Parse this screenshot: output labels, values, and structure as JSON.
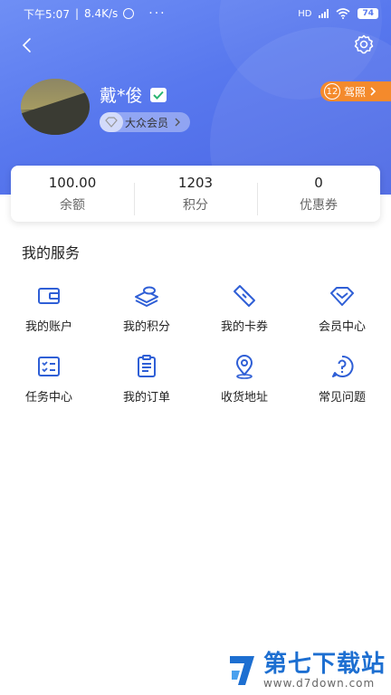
{
  "status_bar": {
    "time": "下午5:07",
    "speed": "8.4K/s",
    "more": "···",
    "network": "HD",
    "battery": "74"
  },
  "profile": {
    "name": "戴*俊",
    "member_level": "大众会员",
    "license_count": "12",
    "license_label": "驾照"
  },
  "stats": [
    {
      "value": "100.00",
      "label": "余额"
    },
    {
      "value": "1203",
      "label": "积分"
    },
    {
      "value": "0",
      "label": "优惠券"
    }
  ],
  "services": {
    "title": "我的服务",
    "items": [
      {
        "label": "我的账户",
        "icon": "wallet-icon"
      },
      {
        "label": "我的积分",
        "icon": "coins-icon"
      },
      {
        "label": "我的卡券",
        "icon": "ticket-icon"
      },
      {
        "label": "会员中心",
        "icon": "diamond-icon"
      },
      {
        "label": "任务中心",
        "icon": "task-list-icon"
      },
      {
        "label": "我的订单",
        "icon": "order-icon"
      },
      {
        "label": "收货地址",
        "icon": "location-icon"
      },
      {
        "label": "常见问题",
        "icon": "question-icon"
      }
    ]
  },
  "watermark": {
    "title": "第七下载站",
    "url": "www.d7down.com"
  },
  "colors": {
    "header_start": "#6f8ff5",
    "header_end": "#4a66e4",
    "icon_blue": "#2f5fd6",
    "license_orange": "#f48a2c"
  }
}
